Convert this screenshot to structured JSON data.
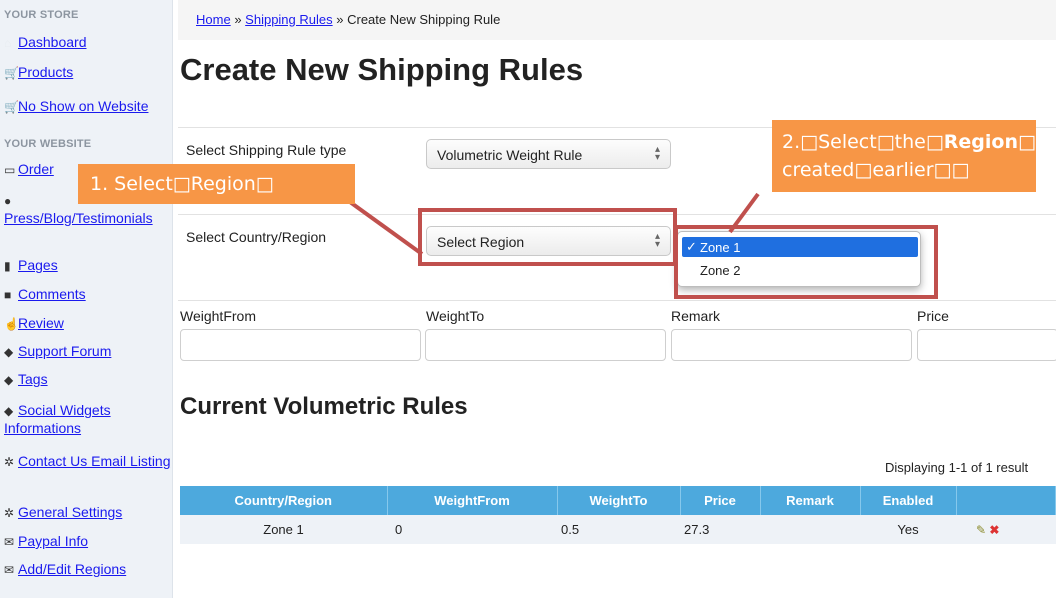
{
  "sidebar": {
    "header_store": "YOUR STORE",
    "header_website": "YOUR WEBSITE",
    "items": [
      {
        "label": "Dashboard",
        "icon": "home-icon"
      },
      {
        "label": "Products",
        "icon": "cart-icon"
      },
      {
        "label": "No Show on Website",
        "icon": "cart-icon"
      },
      {
        "label": "Order",
        "icon": "inbox-icon"
      },
      {
        "label": "Press/Blog/Testimonials",
        "icon": "user-icon"
      },
      {
        "label": "Pages",
        "icon": "file-icon"
      },
      {
        "label": "Comments",
        "icon": "comment-icon"
      },
      {
        "label": "Review",
        "icon": "thumbs-up-icon"
      },
      {
        "label": "Support Forum",
        "icon": "tag-icon"
      },
      {
        "label": "Tags",
        "icon": "tag-icon"
      },
      {
        "label": "Social Widgets Informations",
        "icon": "tag-icon"
      },
      {
        "label": "Contact Us Email Listing",
        "icon": "gear-icon"
      },
      {
        "label": "General Settings",
        "icon": "gear-icon"
      },
      {
        "label": "Paypal Info",
        "icon": "envelope-icon"
      },
      {
        "label": "Add/Edit Regions",
        "icon": "envelope-icon"
      }
    ]
  },
  "breadcrumb": {
    "home": "Home",
    "sep": "»",
    "shipping_rules": "Shipping Rules",
    "current": "Create New Shipping Rule"
  },
  "page_title": "Create New Shipping Rules",
  "form": {
    "rule_type_label": "Select Shipping Rule type",
    "rule_type_value": "Volumetric Weight Rule",
    "country_label": "Select Country/Region",
    "country_value": "Select Region",
    "weight_from_label": "WeightFrom",
    "weight_to_label": "WeightTo",
    "remark_label": "Remark",
    "price_label": "Price"
  },
  "dropdown": {
    "check": "✓",
    "options": [
      "Zone 1",
      "Zone 2"
    ],
    "selected": "Zone 1"
  },
  "current_rules": {
    "title": "Current Volumetric Rules",
    "displaying": "Displaying 1-1 of 1 result",
    "headers": [
      "Country/Region",
      "WeightFrom",
      "WeightTo",
      "Price",
      "Remark",
      "Enabled",
      ""
    ],
    "rows": [
      {
        "country": "Zone 1",
        "weight_from": "0",
        "weight_to": "0.5",
        "price": "27.3",
        "remark": "",
        "enabled": "Yes"
      }
    ]
  },
  "annotations": {
    "step1": "1.  Select□Region□",
    "step2_line1_a": "2.□Select□the□",
    "step2_line1_b": "Region",
    "step2_line1_c": "□",
    "step2_line2": "created□earlier□□",
    "callout_color": "#f79646",
    "highlight_color": "#c0504d"
  },
  "colors": {
    "link": "#1a1aee",
    "table_header": "#4da9dd",
    "dropdown_selected": "#1f6fe0"
  }
}
